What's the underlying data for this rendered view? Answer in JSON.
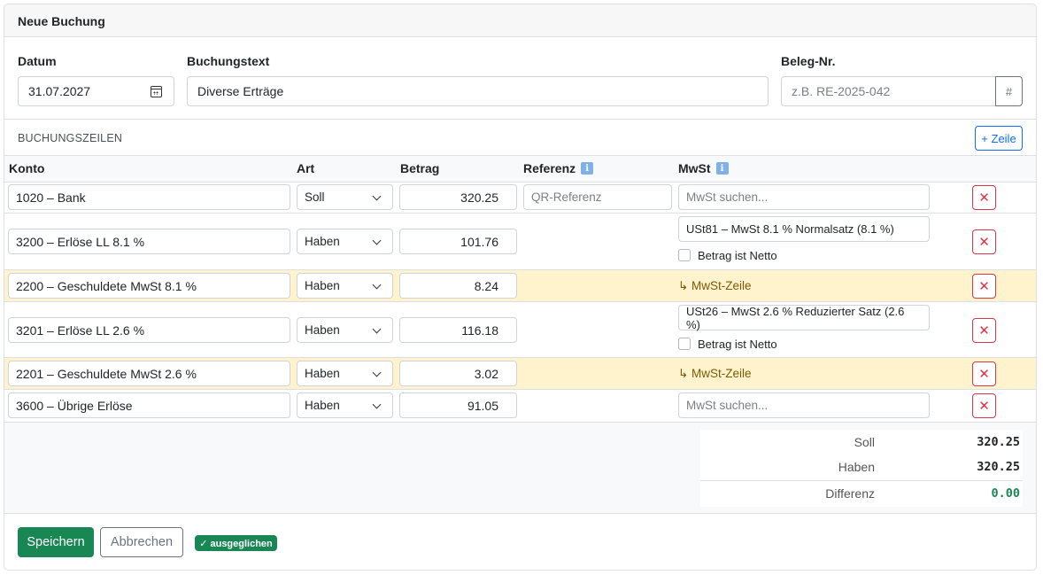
{
  "header": {
    "title": "Neue Buchung"
  },
  "form": {
    "date_label": "Datum",
    "date_value": "31.07.2027",
    "text_label": "Buchungstext",
    "text_value": "Diverse Erträge",
    "receipt_label": "Beleg-Nr.",
    "receipt_placeholder": "z.B. RE-2025-042",
    "receipt_button": "#"
  },
  "lines_section": {
    "title": "BUCHUNGSZEILEN",
    "add_button": "+ Zeile",
    "columns": {
      "account": "Konto",
      "type": "Art",
      "amount": "Betrag",
      "reference": "Referenz",
      "vat": "MwSt"
    },
    "info_glyph": "i",
    "delete_glyph": "✕",
    "reference_placeholder": "QR-Referenz",
    "vat_placeholder": "MwSt suchen...",
    "net_label": "Betrag ist Netto",
    "tax_line_note": "↳ MwSt-Zeile",
    "rows": [
      {
        "account": "1020 – Bank",
        "type": "Soll",
        "amount": "320.25",
        "vat": ""
      },
      {
        "account": "3200 – Erlöse LL 8.1 %",
        "type": "Haben",
        "amount": "101.76",
        "vat": "USt81 – MwSt 8.1 % Normalsatz (8.1 %)"
      },
      {
        "account": "2200 – Geschuldete MwSt 8.1 %",
        "type": "Haben",
        "amount": "8.24"
      },
      {
        "account": "3201 – Erlöse LL 2.6 %",
        "type": "Haben",
        "amount": "116.18",
        "vat": "USt26 – MwSt 2.6 % Reduzierter Satz (2.6 %)"
      },
      {
        "account": "2201 – Geschuldete MwSt 2.6 %",
        "type": "Haben",
        "amount": "3.02"
      },
      {
        "account": "3600 – Übrige Erlöse",
        "type": "Haben",
        "amount": "91.05",
        "vat": ""
      }
    ]
  },
  "totals": {
    "debit_label": "Soll",
    "debit_value": "320.25",
    "credit_label": "Haben",
    "credit_value": "320.25",
    "diff_label": "Differenz",
    "diff_value": "0.00"
  },
  "footer": {
    "save_label": "Speichern",
    "cancel_label": "Abbrechen",
    "status_badge": "✓ ausgeglichen"
  },
  "colors": {
    "primary": "#0d6efd",
    "success": "#198754",
    "danger": "#dc3545",
    "tax_row_bg": "#fff3cd",
    "info_icon": "#7fb1e6"
  },
  "icons": {
    "date": "calendar-icon",
    "info": "info-icon",
    "delete": "x-icon",
    "select": "chevron-down-icon"
  }
}
